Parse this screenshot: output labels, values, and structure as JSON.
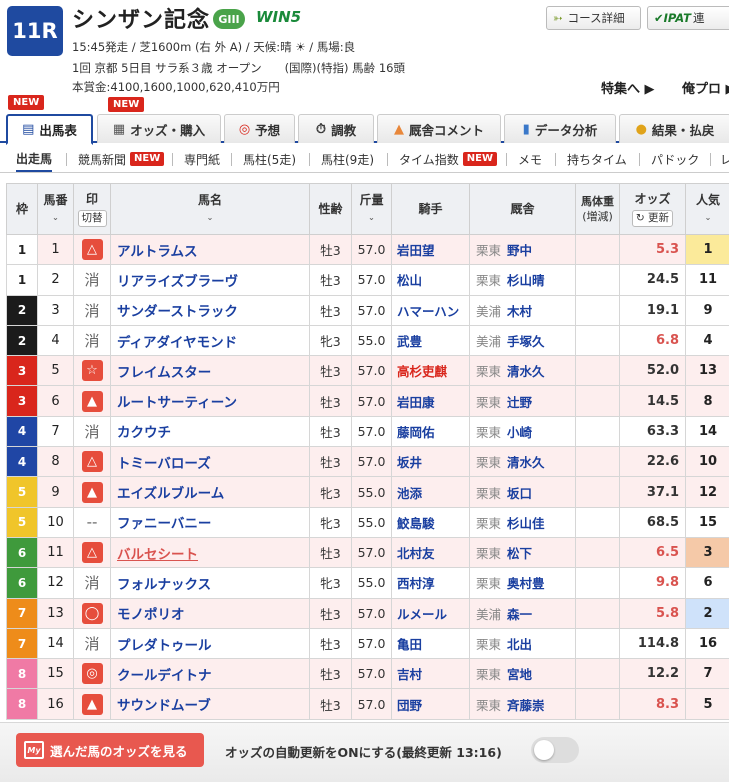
{
  "race": {
    "number": "11R",
    "name": "シンザン記念",
    "grade": "GIII",
    "win5": "WIN5",
    "info1": "15:45発走 / 芝1600m (右 外 A) / 天候:晴 ☀ / 馬場:良",
    "info2": "1回 京都 5日目 サラ系３歳 オープン　　(国際)(特指) 馬齢 16頭",
    "info3": "本賞金:4100,1600,1000,620,410万円"
  },
  "header": {
    "course_btn": "コース詳細",
    "ipat_logo": "IPAT",
    "ipat_btn": "連",
    "feature_link": "特集へ ▶",
    "ore_link": "俺プロ ▶"
  },
  "badges": {
    "new": "NEW"
  },
  "tabs": [
    {
      "label": "出馬表",
      "icon": "📋"
    },
    {
      "label": "オッズ・購入",
      "icon": "▦"
    },
    {
      "label": "予想",
      "icon": "◎"
    },
    {
      "label": "調教",
      "icon": "⏱"
    },
    {
      "label": "厩舎コメント",
      "icon": "▲"
    },
    {
      "label": "データ分析",
      "icon": "▮"
    },
    {
      "label": "結果・払戻",
      "icon": "●"
    }
  ],
  "subnav": [
    "出走馬",
    "競馬新聞",
    "専門紙",
    "馬柱(5走)",
    "馬柱(9走)",
    "タイム指数",
    "メモ",
    "持ちタイム",
    "パドック",
    "レ"
  ],
  "columns": {
    "waku": "枠",
    "umaban": "馬番",
    "mark": "印",
    "mark_sub": "切替",
    "horse": "馬名",
    "sex": "性齢",
    "kin": "斤量",
    "jockey": "騎手",
    "stable": "厩舎",
    "weight": "馬体重",
    "weight_sub": "(増減)",
    "odds": "オッズ",
    "odds_sub": "↻ 更新",
    "pop": "人気"
  },
  "rows": [
    {
      "waku": "1",
      "umaban": "1",
      "mark": "△",
      "horse": "アルトラムス",
      "sex": "牡3",
      "kin": "57.0",
      "jockey": "岩田望",
      "loc": "栗東",
      "trainer": "野中",
      "odds": "5.3",
      "pop": "1",
      "hl": true
    },
    {
      "waku": "1",
      "umaban": "2",
      "mark": "消",
      "horse": "リアライズブラーヴ",
      "sex": "牡3",
      "kin": "57.0",
      "jockey": "松山",
      "loc": "栗東",
      "trainer": "杉山晴",
      "odds": "24.5",
      "pop": "11",
      "hl": false
    },
    {
      "waku": "2",
      "umaban": "3",
      "mark": "消",
      "horse": "サンダーストラック",
      "sex": "牡3",
      "kin": "57.0",
      "jockey": "ハマーハン",
      "loc": "美浦",
      "trainer": "木村",
      "odds": "19.1",
      "pop": "9",
      "hl": false
    },
    {
      "waku": "2",
      "umaban": "4",
      "mark": "消",
      "horse": "ディアダイヤモンド",
      "sex": "牝3",
      "kin": "55.0",
      "jockey": "武豊",
      "loc": "美浦",
      "trainer": "手塚久",
      "odds": "6.8",
      "pop": "4",
      "hl": false
    },
    {
      "waku": "3",
      "umaban": "5",
      "mark": "☆",
      "horse": "フレイムスター",
      "sex": "牡3",
      "kin": "57.0",
      "jockey": "高杉吏麒",
      "loc": "栗東",
      "trainer": "清水久",
      "odds": "52.0",
      "pop": "13",
      "hl": true
    },
    {
      "waku": "3",
      "umaban": "6",
      "mark": "▲",
      "horse": "ルートサーティーン",
      "sex": "牡3",
      "kin": "57.0",
      "jockey": "岩田康",
      "loc": "栗東",
      "trainer": "辻野",
      "odds": "14.5",
      "pop": "8",
      "hl": true
    },
    {
      "waku": "4",
      "umaban": "7",
      "mark": "消",
      "horse": "カクウチ",
      "sex": "牡3",
      "kin": "57.0",
      "jockey": "藤岡佑",
      "loc": "栗東",
      "trainer": "小崎",
      "odds": "63.3",
      "pop": "14",
      "hl": false
    },
    {
      "waku": "4",
      "umaban": "8",
      "mark": "△",
      "horse": "トミーバローズ",
      "sex": "牡3",
      "kin": "57.0",
      "jockey": "坂井",
      "loc": "栗東",
      "trainer": "清水久",
      "odds": "22.6",
      "pop": "10",
      "hl": true
    },
    {
      "waku": "5",
      "umaban": "9",
      "mark": "▲",
      "horse": "エイズルブルーム",
      "sex": "牝3",
      "kin": "55.0",
      "jockey": "池添",
      "loc": "栗東",
      "trainer": "坂口",
      "odds": "37.1",
      "pop": "12",
      "hl": true
    },
    {
      "waku": "5",
      "umaban": "10",
      "mark": "--",
      "horse": "ファニーバニー",
      "sex": "牝3",
      "kin": "55.0",
      "jockey": "鮫島駿",
      "loc": "栗東",
      "trainer": "杉山佳",
      "odds": "68.5",
      "pop": "15",
      "hl": false
    },
    {
      "waku": "6",
      "umaban": "11",
      "mark": "△",
      "horse": "バルセシート",
      "sex": "牡3",
      "kin": "57.0",
      "jockey": "北村友",
      "loc": "栗東",
      "trainer": "松下",
      "odds": "6.5",
      "pop": "3",
      "hl": true
    },
    {
      "waku": "6",
      "umaban": "12",
      "mark": "消",
      "horse": "フォルナックス",
      "sex": "牝3",
      "kin": "55.0",
      "jockey": "西村淳",
      "loc": "栗東",
      "trainer": "奥村豊",
      "odds": "9.8",
      "pop": "6",
      "hl": false
    },
    {
      "waku": "7",
      "umaban": "13",
      "mark": "◯",
      "horse": "モノポリオ",
      "sex": "牡3",
      "kin": "57.0",
      "jockey": "ルメール",
      "loc": "美浦",
      "trainer": "森一",
      "odds": "5.8",
      "pop": "2",
      "hl": true
    },
    {
      "waku": "7",
      "umaban": "14",
      "mark": "消",
      "horse": "プレダトゥール",
      "sex": "牡3",
      "kin": "57.0",
      "jockey": "亀田",
      "loc": "栗東",
      "trainer": "北出",
      "odds": "114.8",
      "pop": "16",
      "hl": false
    },
    {
      "waku": "8",
      "umaban": "15",
      "mark": "◎",
      "horse": "クールデイトナ",
      "sex": "牡3",
      "kin": "57.0",
      "jockey": "吉村",
      "loc": "栗東",
      "trainer": "宮地",
      "odds": "12.2",
      "pop": "7",
      "hl": true
    },
    {
      "waku": "8",
      "umaban": "16",
      "mark": "▲",
      "horse": "サウンドムーブ",
      "sex": "牡3",
      "kin": "57.0",
      "jockey": "団野",
      "loc": "栗東",
      "trainer": "斉藤崇",
      "odds": "8.3",
      "pop": "5",
      "hl": true
    }
  ],
  "footer": {
    "my_label": "My",
    "odds_btn": "選んだ馬のオッズを見る",
    "auto_update": "オッズの自動更新をONにする(最終更新 13:16)"
  },
  "colors": {
    "brand": "#1f4aa0",
    "new_badge": "#d9261c",
    "mark": "#e64d3c"
  }
}
